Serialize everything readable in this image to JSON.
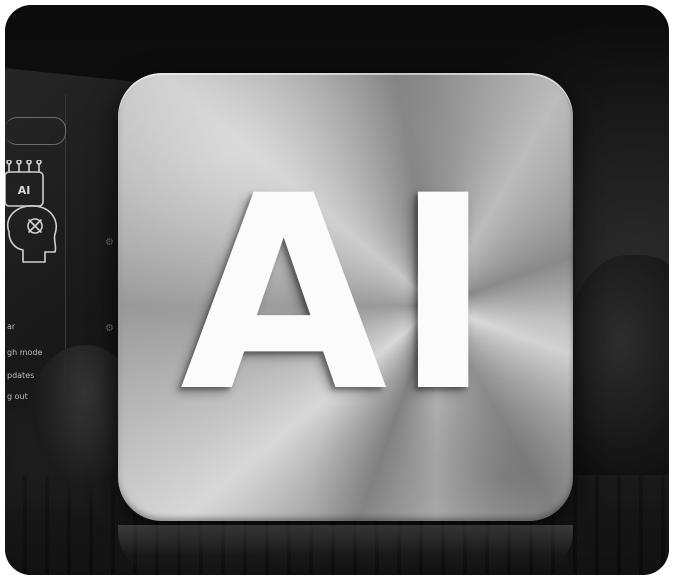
{
  "tile": {
    "text": "AI"
  },
  "background_screen": {
    "labels": [
      "ar",
      "gh mode",
      "pdates",
      "g out"
    ],
    "icon_name": "ai-head-icon",
    "gear_icons": [
      "gear-icon",
      "gear-icon"
    ]
  },
  "colors": {
    "background": "#0c0c0c",
    "tile_metal": "#bdbdbd",
    "text": "#fbfbfb"
  }
}
